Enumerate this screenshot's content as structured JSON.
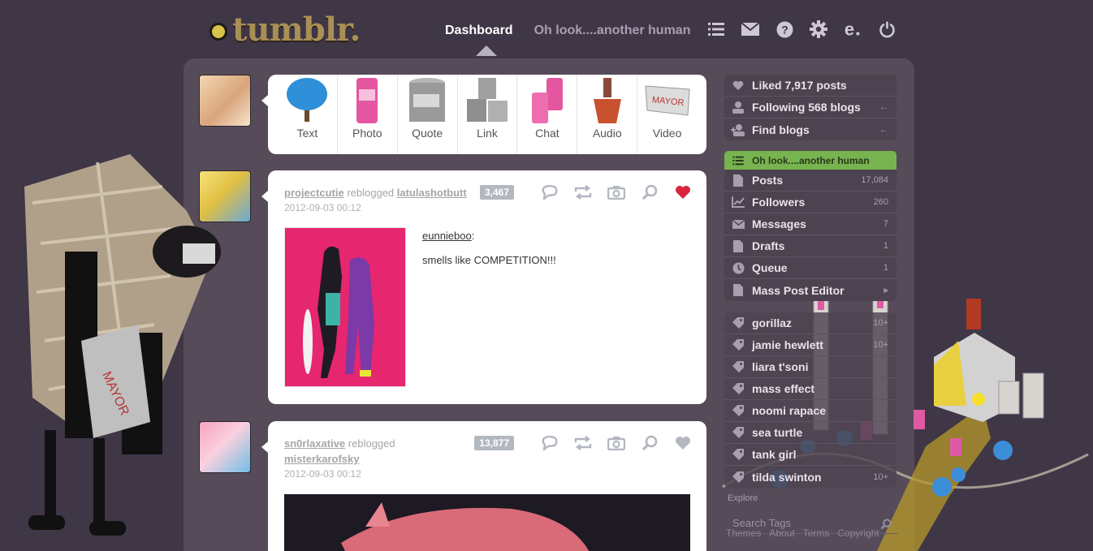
{
  "header": {
    "logo_text": "tumblr.",
    "nav": {
      "dashboard": "Dashboard",
      "blog": "Oh look....another human"
    },
    "icons": [
      "list-icon",
      "mail-icon",
      "help-icon",
      "settings-icon",
      "etsy-e-icon",
      "power-icon"
    ]
  },
  "post_types": [
    {
      "label": "Text",
      "art": "tree-icon"
    },
    {
      "label": "Photo",
      "art": "soda-can-icon"
    },
    {
      "label": "Quote",
      "art": "peas-can-icon"
    },
    {
      "label": "Link",
      "art": "stacked-cans-icon"
    },
    {
      "label": "Chat",
      "art": "soda-cans-icon"
    },
    {
      "label": "Audio",
      "art": "potted-plant-icon"
    },
    {
      "label": "Video",
      "art": "mayor-sign-icon"
    }
  ],
  "posts": [
    {
      "author": "projectcutie",
      "action": "reblogged",
      "source": "latulashotbutt",
      "date": "2012-09-03 00:12",
      "notes": "3,467",
      "liked": true,
      "quote_source": "eunnieboo",
      "body": "smells like COMPETITION!!!"
    },
    {
      "author": "sn0rlaxative",
      "action": "reblogged",
      "source": "misterkarofsky",
      "date": "2012-09-03 00:12",
      "notes": "13,877",
      "liked": false
    }
  ],
  "sidebar": {
    "account": [
      {
        "label": "Liked 7,917 posts",
        "icon": "heart-icon",
        "count": ""
      },
      {
        "label": "Following 568 blogs",
        "icon": "person-icon",
        "count": "←"
      },
      {
        "label": "Find blogs",
        "icon": "add-person-icon",
        "count": "←"
      }
    ],
    "blog_header": "Oh look....another human",
    "blog": [
      {
        "label": "Posts",
        "icon": "document-icon",
        "count": "17,084"
      },
      {
        "label": "Followers",
        "icon": "chart-icon",
        "count": "260"
      },
      {
        "label": "Messages",
        "icon": "mail-icon",
        "count": "7"
      },
      {
        "label": "Drafts",
        "icon": "document-icon",
        "count": "1"
      },
      {
        "label": "Queue",
        "icon": "clock-icon",
        "count": "1"
      },
      {
        "label": "Mass Post Editor",
        "icon": "document-icon",
        "count": "▸"
      }
    ],
    "tags": [
      {
        "label": "gorillaz",
        "count": "10+"
      },
      {
        "label": "jamie hewlett",
        "count": "10+"
      },
      {
        "label": "liara t'soni",
        "count": ""
      },
      {
        "label": "mass effect",
        "count": ""
      },
      {
        "label": "noomi rapace",
        "count": ""
      },
      {
        "label": "sea turtle",
        "count": ""
      },
      {
        "label": "tank girl",
        "count": ""
      },
      {
        "label": "tilda swinton",
        "count": "10+"
      }
    ],
    "explore": "Explore",
    "search_placeholder": "Search Tags",
    "footer": [
      "Themes",
      "About",
      "Terms",
      "Copyright"
    ]
  },
  "colors": {
    "background": "#3f3646",
    "accent_green": "#77b34f",
    "like_red": "#d7263a"
  }
}
